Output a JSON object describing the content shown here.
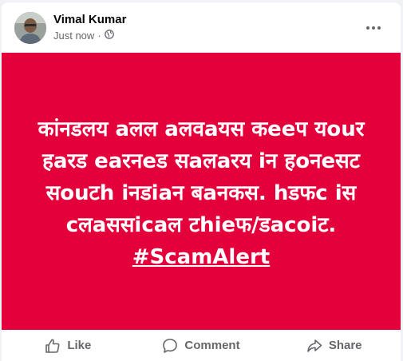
{
  "post": {
    "author": "Vimal Kumar",
    "timestamp": "Just now",
    "separator": "·",
    "privacy_icon": "globe-icon",
    "more_icon": "more-options-icon"
  },
  "banner": {
    "background": "#e4003a",
    "text_color": "#ffffff",
    "text": "कांनडलय aलल aलवaयस कeeप यouर हaरड eaरनeड सaलaरय iन हoनeसट सouटh iनडiaन बaनकस. hडफc iस cलaससicaल टhieफ/डacoiट.",
    "hashtag": "#ScamAlert"
  },
  "actions": {
    "like": "Like",
    "comment": "Comment",
    "share": "Share"
  }
}
